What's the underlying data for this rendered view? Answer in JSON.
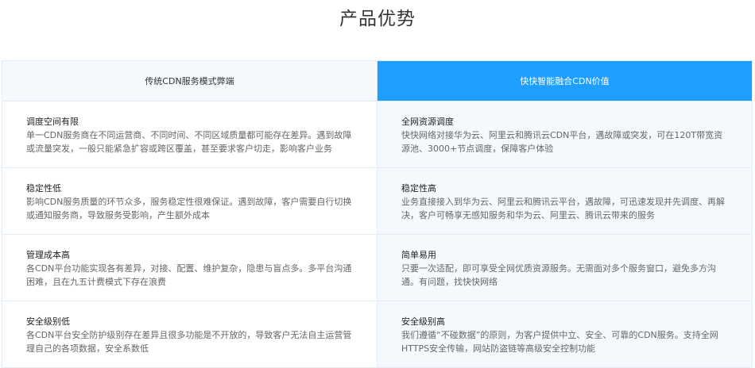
{
  "title": "产品优势",
  "headers": {
    "left": "传统CDN服务模式弊端",
    "right": "快快智能融合CDN价值"
  },
  "rows": [
    {
      "left": {
        "title": "调度空间有限",
        "desc": "单一CDN服务商在不同运营商、不同时间、不同区域质量都可能存在差异。遇到故障或流量突发，一般只能紧急扩容或跨区覆盖，甚至要求客户切走，影响客户业务"
      },
      "right": {
        "title": "全网资源调度",
        "desc": "快快网络对接华为云、阿里云和腾讯云CDN平台，遇故障或突发，可在120T带宽资源池、3000+节点调度，保障客户体验"
      }
    },
    {
      "left": {
        "title": "稳定性低",
        "desc": "影响CDN服务质量的环节众多，服务稳定性很难保证。遇到故障，客户需要自行切换或通知服务商，导致服务受影响，产生额外成本"
      },
      "right": {
        "title": "稳定性高",
        "desc": "业务直接接入到华为云、阿里云和腾讯云平台，遇故障，可迅速发现并先调度、再解决，客户可畅享无感知服务和华为云、阿里云、腾讯云带来的服务"
      }
    },
    {
      "left": {
        "title": "管理成本高",
        "desc": "各CDN平台功能实现各有差异，对接、配置、维护复杂，隐患与盲点多。多平台沟通困难，且在九五计费模式下存在浪费"
      },
      "right": {
        "title": "简单易用",
        "desc": "只要一次适配，即可享受全网优质资源服务。无需面对多个服务窗口，避免多方沟通。有问题，找快快网络"
      }
    },
    {
      "left": {
        "title": "安全级别低",
        "desc": "各CDN平台安全防护级别存在差异且很多功能是不开放的，导致客户无法自主运营管理自己的各项数据，安全系数低"
      },
      "right": {
        "title": "安全级别高",
        "desc": "我们遵循“不碰数据”的原则，为客户提供中立、安全、可靠的CDN服务。支持全网HTTPS安全传输，网站防盗链等高级安全控制功能"
      }
    }
  ]
}
